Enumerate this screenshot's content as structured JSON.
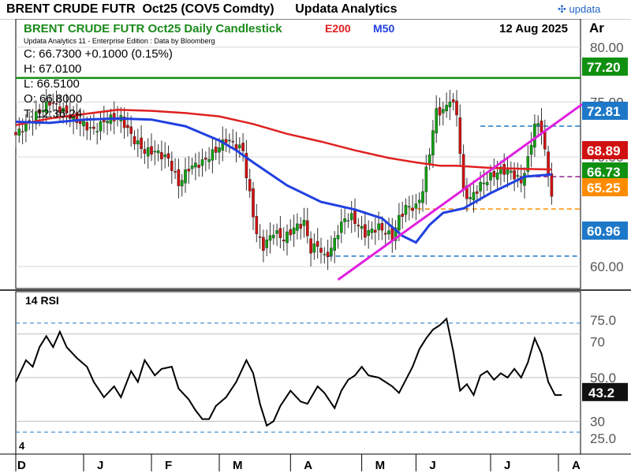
{
  "window": {
    "title": "BRENT CRUDE FUTR  Oct25 (COV5 Comdty)      Updata Analytics",
    "brand": "updata"
  },
  "colors": {
    "ma200": "#e02020",
    "ma50": "#2040e0",
    "title_green": "#1a8a1a",
    "trendline": "#e020e0",
    "resistance_green": "#109010",
    "candle_up": "#10a010",
    "candle_down": "#d01010"
  },
  "chart_data": [
    {
      "type": "candlestick",
      "title": "BRENT CRUDE FUTR  Oct25 Daily Candlestick",
      "date": "12 Aug 2025",
      "legend": [
        {
          "label": "E200",
          "color": "#e02020"
        },
        {
          "label": "M50",
          "color": "#2040e0"
        }
      ],
      "info": {
        "provider": "Updata Analytics 11 - Enterprise Edition : Data by Bloomberg",
        "close": "C: 66.7300  +0.1000 (0.15%)",
        "high": "H: 67.0100",
        "low": "L: 66.5100",
        "open": "O: 66.8000",
        "time": "T: 12:36:24"
      },
      "y_ticks": [
        "80.00",
        "75.00",
        "70.00",
        "60.00"
      ],
      "ylim": [
        58,
        81
      ],
      "x_ticks": [
        "D",
        "J",
        "F",
        "M",
        "A",
        "M",
        "J",
        "J",
        "A"
      ],
      "x_tick_pos": [
        0,
        20,
        40,
        60,
        81,
        102,
        118,
        140,
        160
      ],
      "last_bar_index": 158,
      "series": [
        {
          "name": "price (approx close)",
          "points": [
            [
              0,
              72.0
            ],
            [
              5,
              73.5
            ],
            [
              10,
              75.0
            ],
            [
              14,
              74.2
            ],
            [
              18,
              73.3
            ],
            [
              23,
              72.4
            ],
            [
              27,
              73.5
            ],
            [
              31,
              73.5
            ],
            [
              35,
              71.5
            ],
            [
              38,
              70.5
            ],
            [
              41,
              70.5
            ],
            [
              45,
              69.8
            ],
            [
              48,
              67.5
            ],
            [
              51,
              69.0
            ],
            [
              55,
              69.5
            ],
            [
              59,
              70.6
            ],
            [
              62,
              71.6
            ],
            [
              65,
              71.0
            ],
            [
              67,
              70.6
            ],
            [
              68,
              68.3
            ],
            [
              71,
              63.0
            ],
            [
              73,
              61.8
            ],
            [
              76,
              63.2
            ],
            [
              79,
              62.5
            ],
            [
              82,
              63.5
            ],
            [
              85,
              64.0
            ],
            [
              87,
              61.5
            ],
            [
              89,
              62.0
            ],
            [
              91,
              60.8
            ],
            [
              93,
              61.6
            ],
            [
              95,
              63.2
            ],
            [
              97,
              64.4
            ],
            [
              99,
              64.5
            ],
            [
              103,
              63.0
            ],
            [
              107,
              63.6
            ],
            [
              111,
              62.7
            ],
            [
              113,
              64.4
            ],
            [
              115,
              65.4
            ],
            [
              118,
              65.4
            ],
            [
              120,
              67.0
            ],
            [
              122,
              70.5
            ],
            [
              124,
              74.2
            ],
            [
              126,
              74.1
            ],
            [
              128,
              75.3
            ],
            [
              130,
              74.0
            ],
            [
              132,
              66.8
            ],
            [
              134,
              66.2
            ],
            [
              137,
              67.4
            ],
            [
              140,
              68.2
            ],
            [
              143,
              68.8
            ],
            [
              146,
              68.6
            ],
            [
              149,
              67.7
            ],
            [
              151,
              69.7
            ],
            [
              153,
              73.0
            ],
            [
              155,
              72.6
            ],
            [
              157,
              68.4
            ],
            [
              158,
              66.7
            ]
          ]
        },
        {
          "name": "E200",
          "points": [
            [
              0,
              72.9
            ],
            [
              10,
              73.5
            ],
            [
              20,
              73.9
            ],
            [
              30,
              74.3
            ],
            [
              40,
              74.2
            ],
            [
              50,
              74.0
            ],
            [
              60,
              73.7
            ],
            [
              70,
              73.0
            ],
            [
              80,
              72.1
            ],
            [
              90,
              71.4
            ],
            [
              100,
              70.6
            ],
            [
              110,
              69.9
            ],
            [
              118,
              69.5
            ],
            [
              125,
              69.2
            ],
            [
              130,
              69.2
            ],
            [
              140,
              69.0
            ],
            [
              150,
              68.9
            ],
            [
              158,
              68.85
            ]
          ]
        },
        {
          "name": "M50",
          "points": [
            [
              0,
              73.2
            ],
            [
              10,
              73.1
            ],
            [
              20,
              73.4
            ],
            [
              30,
              73.5
            ],
            [
              40,
              73.4
            ],
            [
              50,
              72.8
            ],
            [
              60,
              71.5
            ],
            [
              65,
              70.6
            ],
            [
              70,
              69.5
            ],
            [
              80,
              67.4
            ],
            [
              90,
              65.9
            ],
            [
              100,
              65.2
            ],
            [
              108,
              64.4
            ],
            [
              114,
              62.8
            ],
            [
              118,
              62.2
            ],
            [
              122,
              63.8
            ],
            [
              126,
              64.9
            ],
            [
              132,
              65.3
            ],
            [
              140,
              66.7
            ],
            [
              150,
              68.2
            ],
            [
              158,
              68.4
            ]
          ]
        }
      ],
      "annotations": {
        "resistance": 77.2,
        "dashed_upper": 72.81,
        "dashed_purple": 68.2,
        "dashed_orange": 65.25,
        "dashed_lower": 60.96,
        "trendline": [
          [
            95,
            58.8
          ],
          [
            158,
            72.8
          ]
        ]
      },
      "price_labels": [
        {
          "value": "77.20",
          "color": "#109010"
        },
        {
          "value": "72.81",
          "color": "#1e78c8"
        },
        {
          "value": "68.89",
          "color": "#d01010"
        },
        {
          "value": "66.73",
          "color": "#109010"
        },
        {
          "value": "65.25",
          "color": "#ff8c00"
        },
        {
          "value": "60.96",
          "color": "#1e78c8"
        }
      ]
    },
    {
      "type": "line",
      "title": "14 RSI",
      "y_ticks": [
        "75.0",
        "70",
        "50.0",
        "30",
        "25.0"
      ],
      "ylim": [
        20,
        80
      ],
      "current": "43.2",
      "series": [
        {
          "values": [
            [
              0,
              48
            ],
            [
              3,
              58
            ],
            [
              5,
              55
            ],
            [
              7,
              64
            ],
            [
              9,
              69
            ],
            [
              11,
              64
            ],
            [
              13,
              71
            ],
            [
              15,
              64
            ],
            [
              18,
              59
            ],
            [
              21,
              55
            ],
            [
              23,
              48
            ],
            [
              26,
              41
            ],
            [
              29,
              46
            ],
            [
              31,
              41
            ],
            [
              34,
              53
            ],
            [
              36,
              48
            ],
            [
              38,
              58
            ],
            [
              41,
              51
            ],
            [
              43,
              54
            ],
            [
              46,
              55
            ],
            [
              48,
              45
            ],
            [
              51,
              40
            ],
            [
              53,
              35
            ],
            [
              55,
              31
            ],
            [
              57,
              31
            ],
            [
              59,
              37
            ],
            [
              62,
              41
            ],
            [
              65,
              48
            ],
            [
              68,
              58
            ],
            [
              70,
              52
            ],
            [
              72,
              38
            ],
            [
              74,
              28
            ],
            [
              76,
              30
            ],
            [
              78,
              37
            ],
            [
              81,
              44
            ],
            [
              84,
              39
            ],
            [
              86,
              38
            ],
            [
              89,
              46
            ],
            [
              91,
              43
            ],
            [
              94,
              36
            ],
            [
              96,
              44
            ],
            [
              98,
              49
            ],
            [
              100,
              51
            ],
            [
              102,
              55
            ],
            [
              104,
              51
            ],
            [
              107,
              50
            ],
            [
              109,
              48
            ],
            [
              111,
              46
            ],
            [
              113,
              43
            ],
            [
              115,
              49
            ],
            [
              117,
              55
            ],
            [
              119,
              63
            ],
            [
              121,
              68
            ],
            [
              123,
              72
            ],
            [
              125,
              74
            ],
            [
              127,
              77
            ],
            [
              129,
              62
            ],
            [
              131,
              44
            ],
            [
              133,
              47
            ],
            [
              135,
              42
            ],
            [
              137,
              51
            ],
            [
              139,
              53
            ],
            [
              141,
              49
            ],
            [
              143,
              52
            ],
            [
              145,
              50
            ],
            [
              147,
              54
            ],
            [
              149,
              50
            ],
            [
              151,
              57
            ],
            [
              153,
              68
            ],
            [
              155,
              61
            ],
            [
              157,
              48
            ],
            [
              159,
              42
            ],
            [
              161,
              42
            ]
          ]
        }
      ]
    }
  ]
}
